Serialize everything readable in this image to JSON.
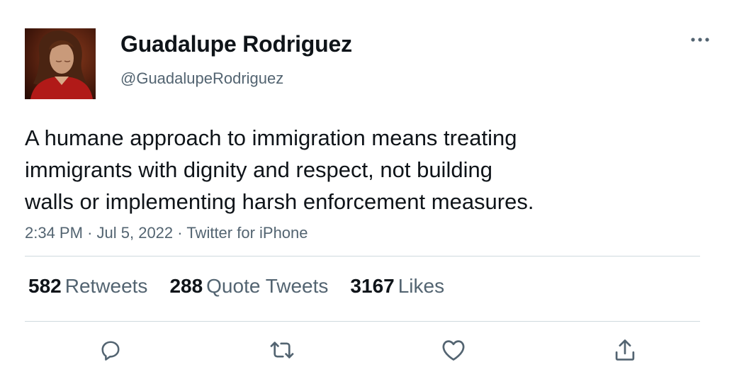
{
  "user": {
    "display_name": "Guadalupe Rodriguez",
    "handle": "@GuadalupeRodriguez",
    "avatar": "profile-photo"
  },
  "tweet": {
    "lines": [
      "A humane approach to immigration means treating",
      "immigrants with dignity and respect, not building",
      "walls or implementing harsh enforcement measures."
    ],
    "time": "2:34 PM",
    "date": "Jul 5, 2022",
    "client": "Twitter for iPhone",
    "separator": "·"
  },
  "stats": {
    "retweets": {
      "count": "582",
      "label": "Retweets"
    },
    "quotes": {
      "count": "288",
      "label": "Quote Tweets"
    },
    "likes": {
      "count": "3167",
      "label": "Likes"
    }
  },
  "icons": {
    "more": "more-dots-icon",
    "reply": "reply-icon",
    "retweet": "retweet-icon",
    "like": "heart-icon",
    "share": "share-icon"
  },
  "colors": {
    "text": "#0f1419",
    "secondary": "#536471",
    "divider": "#cfd9de",
    "background": "#ffffff"
  }
}
